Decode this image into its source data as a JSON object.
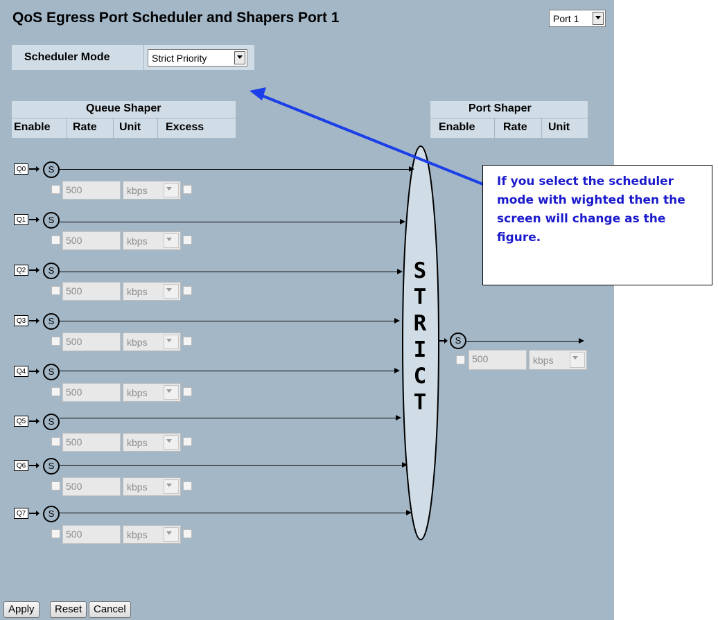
{
  "page": {
    "title": "QoS Egress Port Scheduler and Shapers  Port 1",
    "port_select": "Port 1"
  },
  "scheduler": {
    "label": "Scheduler Mode",
    "value": "Strict Priority"
  },
  "queue_shaper": {
    "header": "Queue Shaper",
    "columns": [
      "Enable",
      "Rate",
      "Unit",
      "Excess"
    ]
  },
  "port_shaper": {
    "header": "Port Shaper",
    "columns": [
      "Enable",
      "Rate",
      "Unit"
    ],
    "scheduler_symbol": "S",
    "rate": "500",
    "unit": "kbps",
    "enabled": false
  },
  "strict_ellipse": {
    "letters": [
      "S",
      "T",
      "R",
      "I",
      "C",
      "T"
    ]
  },
  "queues": [
    {
      "label": "Q0",
      "symbol": "S",
      "rate": "500",
      "unit": "kbps",
      "enabled": false,
      "excess": false
    },
    {
      "label": "Q1",
      "symbol": "S",
      "rate": "500",
      "unit": "kbps",
      "enabled": false,
      "excess": false
    },
    {
      "label": "Q2",
      "symbol": "S",
      "rate": "500",
      "unit": "kbps",
      "enabled": false,
      "excess": false
    },
    {
      "label": "Q3",
      "symbol": "S",
      "rate": "500",
      "unit": "kbps",
      "enabled": false,
      "excess": false
    },
    {
      "label": "Q4",
      "symbol": "S",
      "rate": "500",
      "unit": "kbps",
      "enabled": false,
      "excess": false
    },
    {
      "label": "Q5",
      "symbol": "S",
      "rate": "500",
      "unit": "kbps",
      "enabled": false,
      "excess": false
    },
    {
      "label": "Q6",
      "symbol": "S",
      "rate": "500",
      "unit": "kbps",
      "enabled": false,
      "excess": false
    },
    {
      "label": "Q7",
      "symbol": "S",
      "rate": "500",
      "unit": "kbps",
      "enabled": false,
      "excess": false
    }
  ],
  "buttons": {
    "apply": "Apply",
    "reset": "Reset",
    "cancel": "Cancel"
  },
  "callout": {
    "text": "If you select the scheduler mode with wighted then the screen will change as the figure.",
    "arrow_color": "#1a3ee8"
  }
}
